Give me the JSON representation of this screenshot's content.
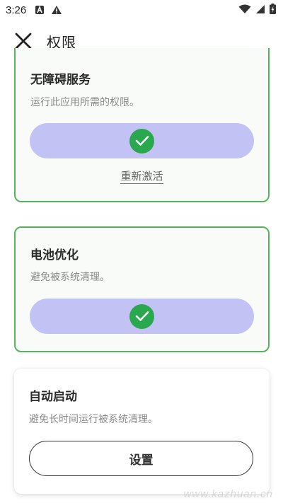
{
  "status_bar": {
    "time": "3:26"
  },
  "app_bar": {
    "title": "权限"
  },
  "cards": {
    "accessibility": {
      "title": "无障碍服务",
      "description": "运行此应用所需的权限。",
      "relink": "重新激活"
    },
    "battery": {
      "title": "电池优化",
      "description": "避免被系统清理。"
    },
    "autostart": {
      "title": "自动启动",
      "description": "避免长时间运行被系统清理。",
      "button": "设置"
    }
  },
  "watermark": "www.kazhuan.cn",
  "colors": {
    "card_border": "#55b45c",
    "granted_bg": "#c2c3f4",
    "check": "#2aa84d"
  }
}
